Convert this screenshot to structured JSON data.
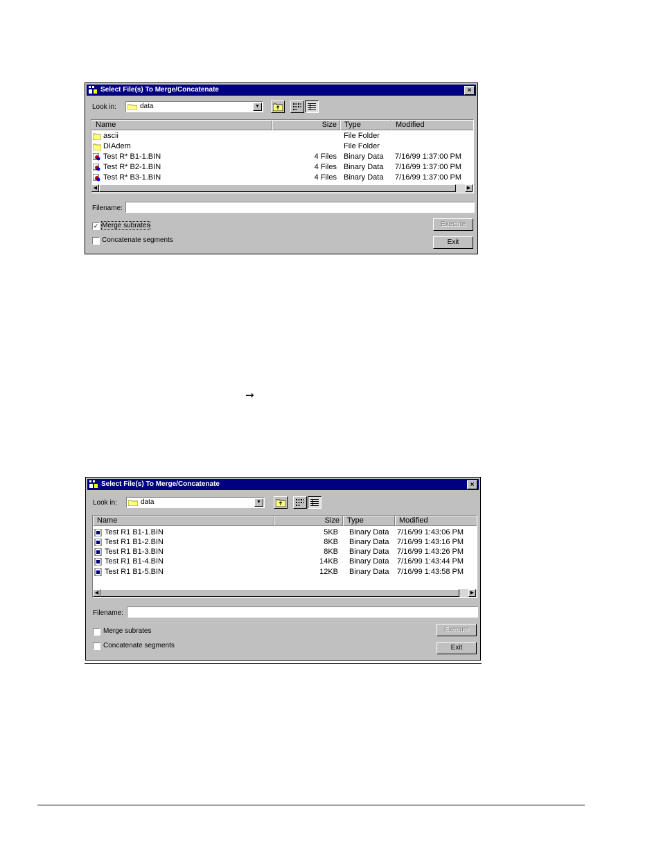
{
  "dialog1": {
    "title": "Select File(s) To Merge/Concatenate",
    "close": "×",
    "look_in_label": "Look in:",
    "look_in_value": "data",
    "columns": [
      "Name",
      "Size",
      "Type",
      "Modified"
    ],
    "rows": [
      {
        "icon": "folder-icon",
        "name": "ascii",
        "size": "",
        "type": "File Folder",
        "modified": ""
      },
      {
        "icon": "folder-icon",
        "name": "DIAdem",
        "size": "",
        "type": "File Folder",
        "modified": ""
      },
      {
        "icon": "multi-file-icon",
        "name": "Test R* B1-1.BIN",
        "size": "4 Files",
        "type": "Binary Data",
        "modified": "7/16/99 1:37:00 PM"
      },
      {
        "icon": "multi-file-icon",
        "name": "Test R* B2-1.BIN",
        "size": "4 Files",
        "type": "Binary Data",
        "modified": "7/16/99 1:37:00 PM"
      },
      {
        "icon": "multi-file-icon",
        "name": "Test R* B3-1.BIN",
        "size": "4 Files",
        "type": "Binary Data",
        "modified": "7/16/99 1:37:00 PM"
      }
    ],
    "filename_label": "Filename:",
    "filename_value": "",
    "merge_label": "Merge subrates",
    "merge_checked": "✓",
    "concat_label": "Concatenate segments",
    "concat_checked": "",
    "execute_label": "Execute",
    "exit_label": "Exit"
  },
  "separator_arrow": "→",
  "dialog2": {
    "title": "Select File(s) To Merge/Concatenate",
    "close": "×",
    "look_in_label": "Look in:",
    "look_in_value": "data",
    "columns": [
      "Name",
      "Size",
      "Type",
      "Modified"
    ],
    "rows": [
      {
        "icon": "binary-file-icon",
        "name": "Test R1 B1-1.BIN",
        "size": "5KB",
        "type": "Binary Data",
        "modified": "7/16/99 1:43:06 PM"
      },
      {
        "icon": "binary-file-icon",
        "name": "Test R1 B1-2.BIN",
        "size": "8KB",
        "type": "Binary Data",
        "modified": "7/16/99 1:43:16 PM"
      },
      {
        "icon": "binary-file-icon",
        "name": "Test R1 B1-3.BIN",
        "size": "8KB",
        "type": "Binary Data",
        "modified": "7/16/99 1:43:26 PM"
      },
      {
        "icon": "binary-file-icon",
        "name": "Test R1 B1-4.BIN",
        "size": "14KB",
        "type": "Binary Data",
        "modified": "7/16/99 1:43:44 PM"
      },
      {
        "icon": "binary-file-icon",
        "name": "Test R1 B1-5.BIN",
        "size": "12KB",
        "type": "Binary Data",
        "modified": "7/16/99 1:43:58 PM"
      }
    ],
    "filename_label": "Filename:",
    "filename_value": "",
    "merge_label": "Merge subrates",
    "merge_checked": "",
    "concat_label": "Concatenate segments",
    "concat_checked": "",
    "execute_label": "Execute",
    "exit_label": "Exit"
  }
}
